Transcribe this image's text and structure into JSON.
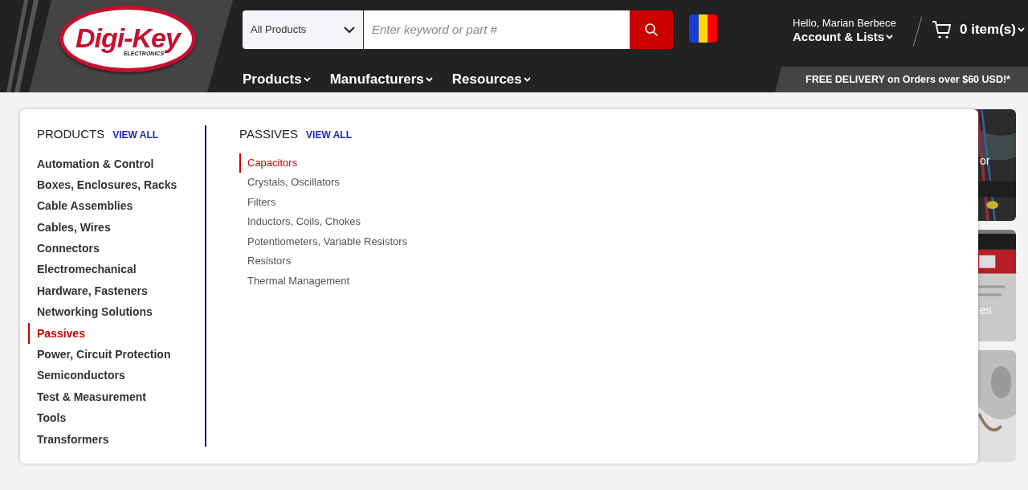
{
  "logo": {
    "wordmark": "Digi-Key",
    "tagline": "ELECTRONICS"
  },
  "search": {
    "category": "All Products",
    "placeholder": "Enter keyword or part #"
  },
  "account": {
    "greeting": "Hello, Marian Berbece",
    "label": "Account & Lists"
  },
  "cart": {
    "label": "0 item(s)"
  },
  "nav": [
    {
      "label": "Products"
    },
    {
      "label": "Manufacturers"
    },
    {
      "label": "Resources"
    }
  ],
  "promo": "FREE DELIVERY on Orders over $60 USD!*",
  "menu": {
    "title": "PRODUCTS",
    "view_all": "VIEW ALL",
    "sub_title": "PASSIVES",
    "sub_view_all": "VIEW ALL",
    "categories": [
      {
        "label": "Automation & Control",
        "selected": false
      },
      {
        "label": "Boxes, Enclosures, Racks",
        "selected": false
      },
      {
        "label": "Cable Assemblies",
        "selected": false
      },
      {
        "label": "Cables, Wires",
        "selected": false
      },
      {
        "label": "Connectors",
        "selected": false
      },
      {
        "label": "Electromechanical",
        "selected": false
      },
      {
        "label": "Hardware, Fasteners",
        "selected": false
      },
      {
        "label": "Networking Solutions",
        "selected": false
      },
      {
        "label": "Passives",
        "selected": true
      },
      {
        "label": "Power, Circuit Protection",
        "selected": false
      },
      {
        "label": "Semiconductors",
        "selected": false
      },
      {
        "label": "Test & Measurement",
        "selected": false
      },
      {
        "label": "Tools",
        "selected": false
      },
      {
        "label": "Transformers",
        "selected": false
      }
    ],
    "subcategories": [
      {
        "label": "Capacitors",
        "selected": true
      },
      {
        "label": "Crystals, Oscillators",
        "selected": false
      },
      {
        "label": "Filters",
        "selected": false
      },
      {
        "label": "Inductors, Coils, Chokes",
        "selected": false
      },
      {
        "label": "Potentiometers, Variable Resistors",
        "selected": false
      },
      {
        "label": "Resistors",
        "selected": false
      },
      {
        "label": "Thermal Management",
        "selected": false
      }
    ]
  },
  "cards": [
    {
      "kind": "picture",
      "caption": "or"
    },
    {
      "kind": "picture",
      "caption": "es"
    },
    {
      "kind": "picture"
    }
  ]
}
